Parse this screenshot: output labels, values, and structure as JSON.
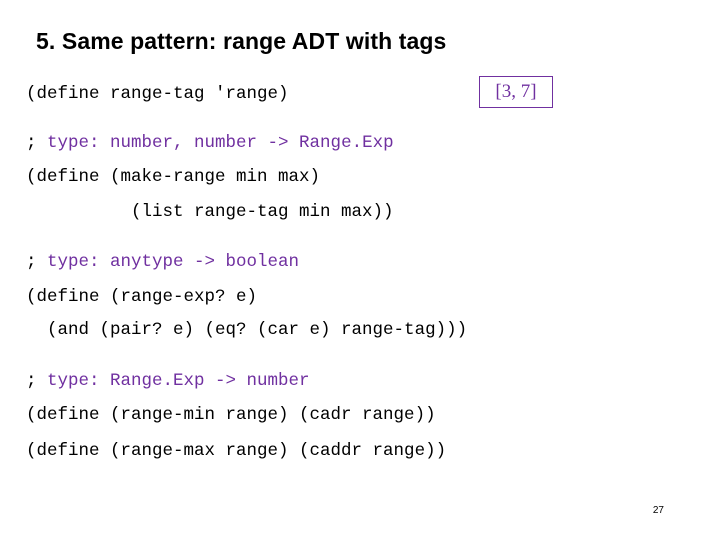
{
  "slide": {
    "title": "5. Same pattern: range ADT with tags",
    "page_number": "27",
    "tag_box": {
      "text": "[3, 7]",
      "border_color": "#7030a0",
      "text_color": "#7030a0"
    },
    "accent_color": "#7030a0",
    "code_lines": [
      {
        "id": "l1",
        "black_prefix": "(define range-tag 'range)",
        "purple": "",
        "black_suffix": ""
      },
      {
        "id": "l2",
        "black_prefix": "; ",
        "purple": "type: number, number -> Range.Exp",
        "black_suffix": ""
      },
      {
        "id": "l3",
        "black_prefix": "(define (make-range min max)",
        "purple": "",
        "black_suffix": ""
      },
      {
        "id": "l4",
        "black_prefix": "          (list range-tag min max))",
        "purple": "",
        "black_suffix": ""
      },
      {
        "id": "l5",
        "black_prefix": "; ",
        "purple": "type: anytype -> boolean",
        "black_suffix": ""
      },
      {
        "id": "l6",
        "black_prefix": "(define (range-exp? e)",
        "purple": "",
        "black_suffix": ""
      },
      {
        "id": "l7",
        "black_prefix": "  (and (pair? e) (eq? (car e) range-tag)))",
        "purple": "",
        "black_suffix": ""
      },
      {
        "id": "l8",
        "black_prefix": "; ",
        "purple": "type: Range.Exp -> number",
        "black_suffix": ""
      },
      {
        "id": "l9",
        "black_prefix": "(define (range-min range) (cadr range))",
        "purple": "",
        "black_suffix": ""
      },
      {
        "id": "l10",
        "black_prefix": "(define (range-max range) (caddr range))",
        "purple": "",
        "black_suffix": ""
      }
    ]
  }
}
